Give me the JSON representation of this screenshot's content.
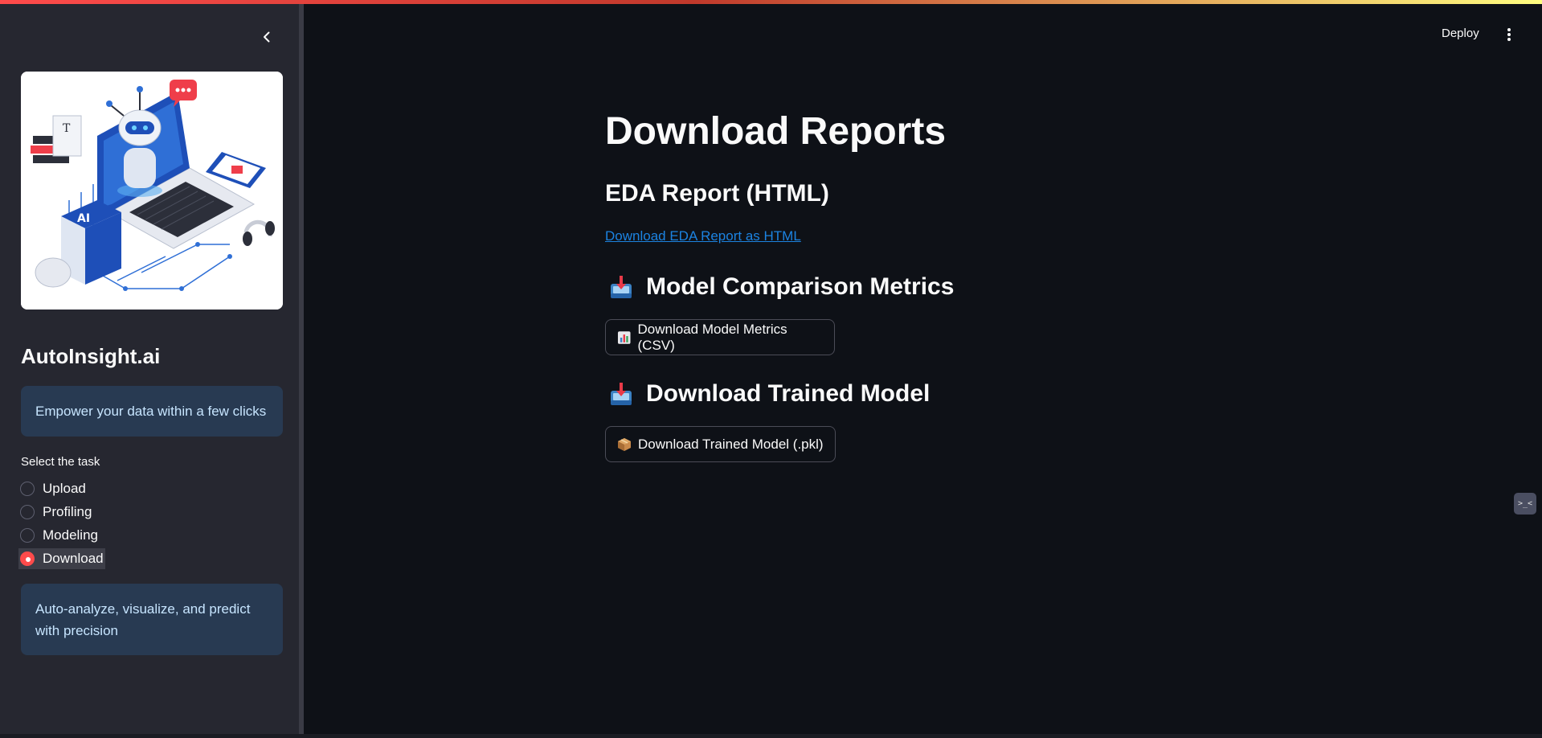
{
  "sidebar": {
    "collapse_icon": "chevron-left-icon",
    "logo_image": "ai-robot-laptop-illustration",
    "app_title": "AutoInsight.ai",
    "tagline": "Empower your data within a few clicks",
    "radio": {
      "label": "Select the task",
      "options": [
        "Upload",
        "Profiling",
        "Modeling",
        "Download"
      ],
      "selected": "Download"
    },
    "footer_note": "Auto-analyze, visualize, and predict with precision"
  },
  "header": {
    "deploy_label": "Deploy",
    "menu_icon": "kebab-menu-icon"
  },
  "main": {
    "title": "Download Reports",
    "eda": {
      "heading": "EDA Report (HTML)",
      "link_text": "Download EDA Report as HTML"
    },
    "metrics": {
      "heading": "Model Comparison Metrics",
      "icon": "inbox-tray-icon",
      "button_label": "Download Model Metrics (CSV)",
      "button_icon": "bar-chart-icon"
    },
    "model": {
      "heading": "Download Trained Model",
      "icon": "inbox-tray-icon",
      "button_label": "Download Trained Model (.pkl)",
      "button_icon": "package-icon"
    }
  },
  "colors": {
    "background": "#0e1117",
    "sidebar": "#262730",
    "accent": "#ff4b4b",
    "info_bg": "#283a52",
    "info_text": "#c7e5ff",
    "link": "#1c83e1"
  }
}
